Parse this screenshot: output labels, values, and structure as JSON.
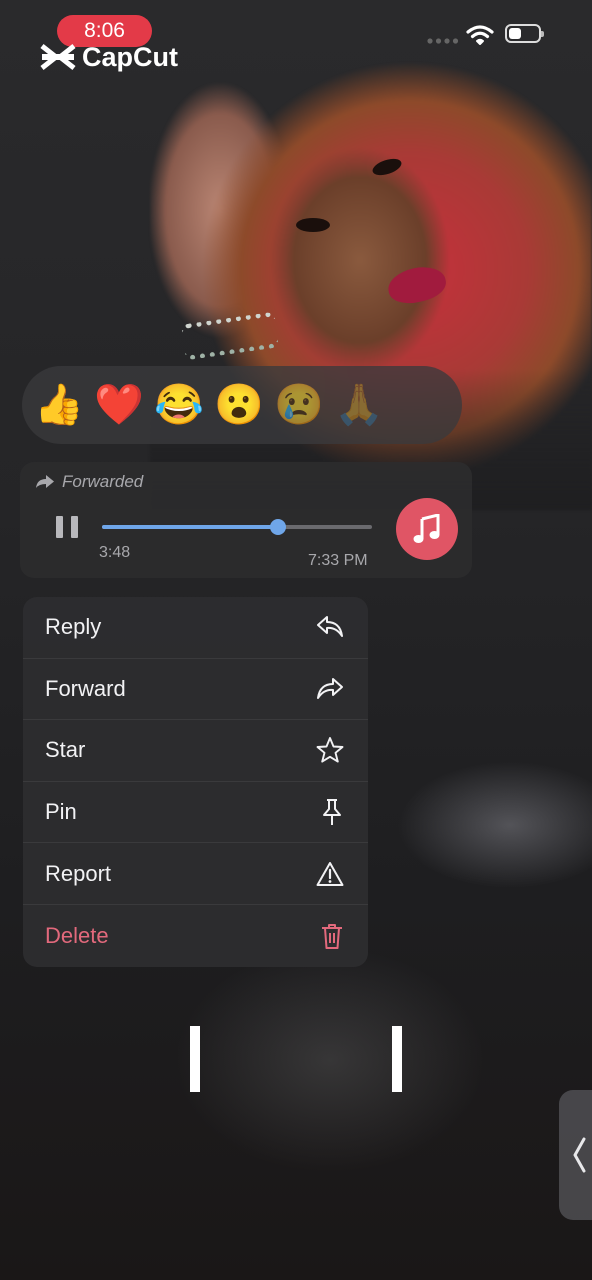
{
  "status_bar": {
    "time": "8:06",
    "watermark": "CapCut"
  },
  "reactions": {
    "items": [
      {
        "emoji": "👍",
        "name": "thumbs-up"
      },
      {
        "emoji": "❤️",
        "name": "red-heart"
      },
      {
        "emoji": "😂",
        "name": "tears-of-joy"
      },
      {
        "emoji": "😮",
        "name": "surprised"
      },
      {
        "emoji": "😢",
        "name": "crying"
      },
      {
        "emoji": "🙏",
        "name": "folded-hands"
      }
    ]
  },
  "message": {
    "forwarded_label": "Forwarded",
    "duration": "3:48",
    "timestamp": "7:33 PM",
    "progress": 0.65
  },
  "menu": {
    "items": [
      {
        "label": "Reply",
        "icon": "reply-icon"
      },
      {
        "label": "Forward",
        "icon": "forward-icon"
      },
      {
        "label": "Star",
        "icon": "star-icon"
      },
      {
        "label": "Pin",
        "icon": "pin-icon"
      },
      {
        "label": "Report",
        "icon": "warning-icon"
      },
      {
        "label": "Delete",
        "icon": "trash-icon"
      }
    ]
  },
  "colors": {
    "accent_blue": "#6fa6e9",
    "music_button": "#e05565",
    "delete_red": "#e2697c",
    "time_pill": "#e33a48"
  }
}
